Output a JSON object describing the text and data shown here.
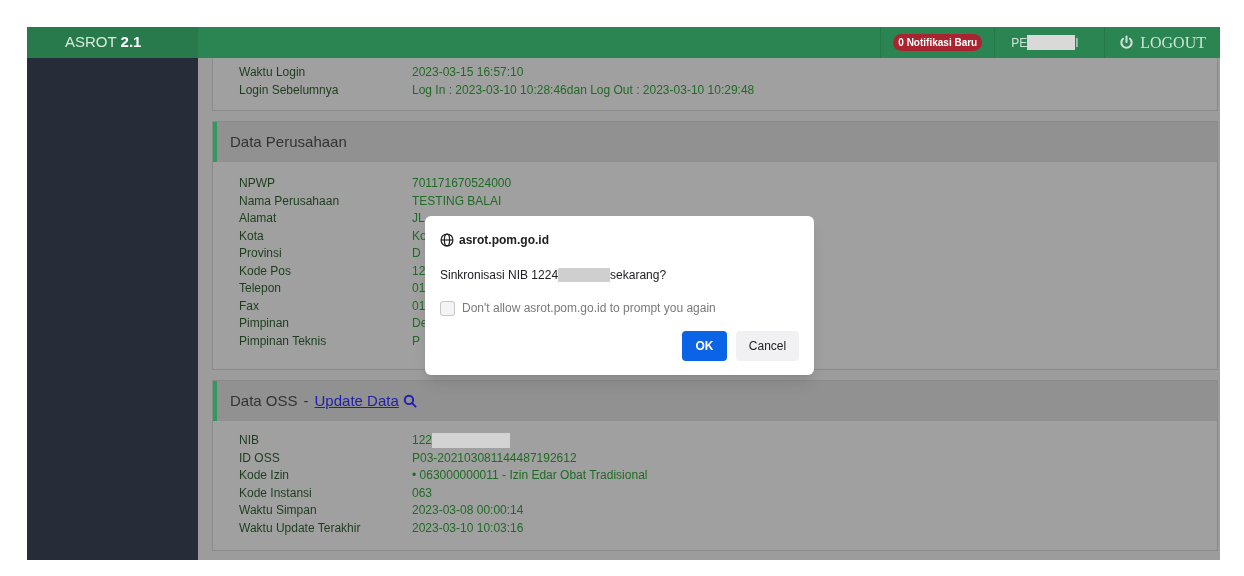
{
  "app": {
    "title": "ASROT",
    "version": "2.1"
  },
  "header": {
    "notification_badge": "0 Notifikasi Baru",
    "user": {
      "prefix": "PE",
      "suffix": "I",
      "redacted": true
    },
    "logout": "LOGOUT"
  },
  "login_panel": {
    "rows": [
      {
        "label": "Waktu Login",
        "value": "2023-03-15 16:57:10",
        "redacted": false
      },
      {
        "label": "Login Sebelumnya",
        "value": "Log In : 2023-03-10 10:28:46dan Log Out : 2023-03-10 10:29:48",
        "redacted": false
      }
    ]
  },
  "sections": [
    {
      "title": "Data Perusahaan",
      "rows": [
        {
          "label": "NPWP",
          "value": "701171670524000",
          "redacted": false
        },
        {
          "label": "Nama Perusahaan",
          "value": "TESTING BALAI",
          "redacted": false
        },
        {
          "label": "Alamat",
          "value": "JL",
          "redacted": false
        },
        {
          "label": "Kota",
          "value": "Ko",
          "redacted": false
        },
        {
          "label": "Provinsi",
          "value": "D",
          "redacted": false
        },
        {
          "label": "Kode Pos",
          "value": "12",
          "redacted": false
        },
        {
          "label": "Telepon",
          "value": "01",
          "redacted": false
        },
        {
          "label": "Fax",
          "value": "01",
          "redacted": false
        },
        {
          "label": "Pimpinan",
          "value": "De",
          "redacted": false
        },
        {
          "label": "Pimpinan Teknis",
          "value": "P",
          "redacted": false
        }
      ]
    },
    {
      "title": "Data OSS",
      "separator": "-",
      "link": "Update Data",
      "rows": [
        {
          "label": "NIB",
          "value": "122",
          "redacted": true
        },
        {
          "label": "ID OSS",
          "value": "P03-202103081144487192612",
          "redacted": false
        },
        {
          "label": "Kode Izin",
          "value": "• 063000000011 - Izin Edar Obat Tradisional",
          "redacted": false
        },
        {
          "label": "Kode Instansi",
          "value": "063",
          "redacted": false
        },
        {
          "label": "Waktu Simpan",
          "value": "2023-03-08 00:00:14",
          "redacted": false
        },
        {
          "label": "Waktu Update Terakhir",
          "value": "2023-03-10 10:03:16",
          "redacted": false
        }
      ]
    }
  ],
  "dialog": {
    "origin": "asrot.pom.go.id",
    "message_start": "Sinkronisasi NIB 1224",
    "message_end": "sekarang?",
    "redacted": true,
    "checkbox": {
      "label": "Don't allow asrot.pom.go.id to prompt you again",
      "checked": false
    },
    "buttons": [
      {
        "label": "OK",
        "kind": "primary"
      },
      {
        "label": "Cancel",
        "kind": "secondary"
      }
    ]
  }
}
